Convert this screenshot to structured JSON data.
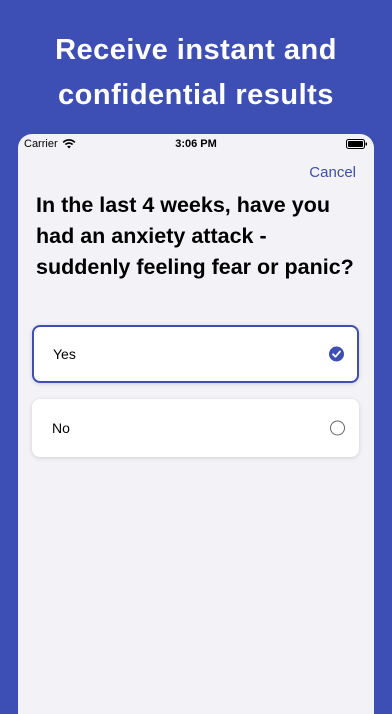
{
  "promo": {
    "heading_line1": "Receive instant and",
    "heading_line2": "confidential results"
  },
  "status_bar": {
    "carrier": "Carrier",
    "time": "3:06 PM"
  },
  "nav": {
    "cancel_label": "Cancel"
  },
  "question": {
    "text": "In the last 4 weeks, have you had an anxiety attack - suddenly feeling fear or panic?"
  },
  "options": [
    {
      "label": "Yes",
      "selected": true
    },
    {
      "label": "No",
      "selected": false
    }
  ],
  "colors": {
    "accent": "#3d4fb5",
    "background": "#f2f2f7"
  },
  "icons": [
    "wifi-icon",
    "battery-icon",
    "check-icon"
  ]
}
